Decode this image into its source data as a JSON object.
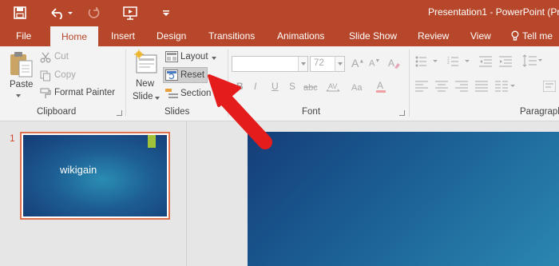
{
  "title_bar": {
    "title": "Presentation1 - PowerPoint (Pr",
    "qat": [
      {
        "icon": "save-icon"
      },
      {
        "icon": "undo-icon"
      },
      {
        "icon": "redo-icon"
      },
      {
        "icon": "start-from-beginning-icon"
      },
      {
        "icon": "customize-qat-icon"
      }
    ]
  },
  "tabs": [
    {
      "label": "File"
    },
    {
      "label": "Home",
      "active": true
    },
    {
      "label": "Insert"
    },
    {
      "label": "Design"
    },
    {
      "label": "Transitions"
    },
    {
      "label": "Animations"
    },
    {
      "label": "Slide Show"
    },
    {
      "label": "Review"
    },
    {
      "label": "View"
    },
    {
      "label": "Tell me",
      "icon": "lightbulb-icon"
    }
  ],
  "ribbon": {
    "clipboard": {
      "paste": "Paste",
      "cut": "Cut",
      "copy": "Copy",
      "format_painter": "Format Painter",
      "group_label": "Clipboard"
    },
    "slides": {
      "new_slide_line1": "New",
      "new_slide_line2": "Slide",
      "layout": "Layout",
      "reset": "Reset",
      "section": "Section",
      "group_label": "Slides"
    },
    "font": {
      "font_name": "",
      "font_size": "72",
      "bold": "B",
      "italic": "I",
      "underline": "U",
      "strikethrough": "S",
      "grow": "A",
      "shrink": "A",
      "group_label": "Font"
    },
    "paragraph": {
      "group_label": "Paragraph"
    }
  },
  "slides_pane": {
    "slide_number": "1",
    "thumbnail_title": "wikigain"
  },
  "colors": {
    "accent": "#b7472a",
    "active_tab_text": "#b7472a",
    "selection_border": "#e0714f",
    "annotation_arrow": "#e41c1c"
  }
}
